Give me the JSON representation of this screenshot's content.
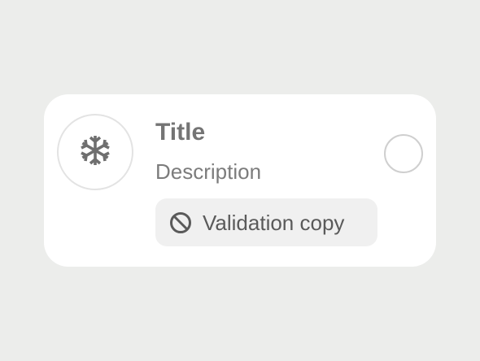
{
  "card": {
    "icon": "snowflake-icon",
    "title": "Title",
    "description": "Description",
    "validation": {
      "icon": "ban-icon",
      "text": "Validation copy"
    },
    "radio": {
      "selected": false
    }
  },
  "colors": {
    "background": "#ecedeb",
    "card": "#ffffff",
    "icon": "#6f6f6f",
    "title": "#747474",
    "description": "#7c7c7c",
    "validation_bg": "#f0f0f0",
    "validation_text": "#5a5a5a"
  }
}
